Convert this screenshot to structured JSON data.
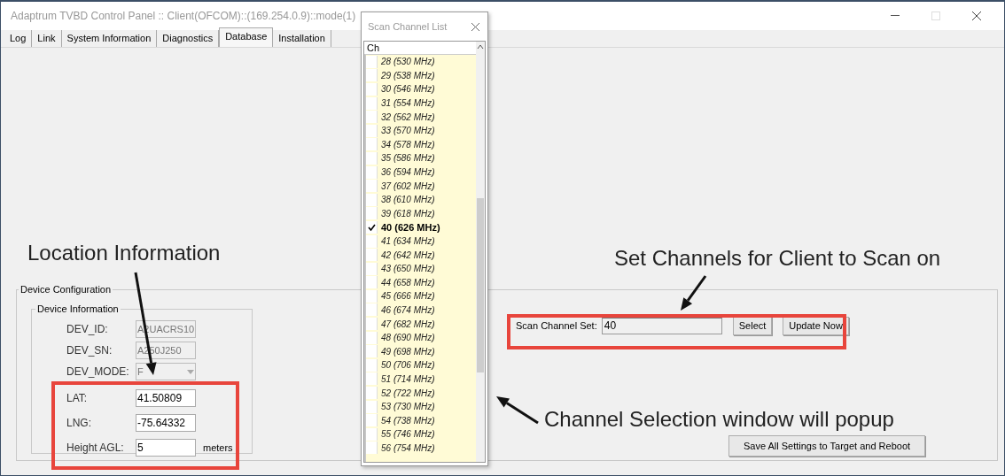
{
  "window": {
    "title": "Adaptrum TVBD Control Panel :: Client(OFCOM)::(169.254.0.9)::mode(1)"
  },
  "tabs": [
    {
      "label": "Log",
      "selected": false
    },
    {
      "label": "Link",
      "selected": false
    },
    {
      "label": "System Information",
      "selected": false
    },
    {
      "label": "Diagnostics",
      "selected": false
    },
    {
      "label": "Database",
      "selected": true
    },
    {
      "label": "Installation",
      "selected": false
    }
  ],
  "device_configuration": {
    "title": "Device Configuration",
    "device_information": {
      "title": "Device Information",
      "fields": [
        {
          "kind": "text",
          "label": "DEV_ID:",
          "value": "A2UACRS10",
          "disabled": true
        },
        {
          "kind": "text",
          "label": "DEV_SN:",
          "value": "A250J250",
          "disabled": true
        },
        {
          "kind": "dropdown",
          "label": "DEV_MODE:",
          "value": "F",
          "disabled": true
        },
        {
          "kind": "text",
          "label": "LAT:",
          "value": "41.50809",
          "disabled": false
        },
        {
          "kind": "text",
          "label": "LNG:",
          "value": "-75.64332",
          "disabled": false
        },
        {
          "kind": "text",
          "label": "Height AGL:",
          "value": "5",
          "disabled": false,
          "unit": "meters"
        }
      ]
    },
    "scan_channel_set": {
      "label": "Scan Channel Set:",
      "value": "40",
      "buttons": [
        "Select",
        "Update Now"
      ]
    },
    "save_button": "Save All Settings to Target and Reboot"
  },
  "popup": {
    "title": "Scan Channel List",
    "column": "Ch",
    "channels": [
      {
        "label": "28 (530 MHz)",
        "checked": false
      },
      {
        "label": "29 (538 MHz)",
        "checked": false
      },
      {
        "label": "30 (546 MHz)",
        "checked": false
      },
      {
        "label": "31 (554 MHz)",
        "checked": false
      },
      {
        "label": "32 (562 MHz)",
        "checked": false
      },
      {
        "label": "33 (570 MHz)",
        "checked": false
      },
      {
        "label": "34 (578 MHz)",
        "checked": false
      },
      {
        "label": "35 (586 MHz)",
        "checked": false
      },
      {
        "label": "36 (594 MHz)",
        "checked": false
      },
      {
        "label": "37 (602 MHz)",
        "checked": false
      },
      {
        "label": "38 (610 MHz)",
        "checked": false
      },
      {
        "label": "39 (618 MHz)",
        "checked": false
      },
      {
        "label": "40 (626 MHz)",
        "checked": true
      },
      {
        "label": "41 (634 MHz)",
        "checked": false
      },
      {
        "label": "42 (642 MHz)",
        "checked": false
      },
      {
        "label": "43 (650 MHz)",
        "checked": false
      },
      {
        "label": "44 (658 MHz)",
        "checked": false
      },
      {
        "label": "45 (666 MHz)",
        "checked": false
      },
      {
        "label": "46 (674 MHz)",
        "checked": false
      },
      {
        "label": "47 (682 MHz)",
        "checked": false
      },
      {
        "label": "48 (690 MHz)",
        "checked": false
      },
      {
        "label": "49 (698 MHz)",
        "checked": false
      },
      {
        "label": "50 (706 MHz)",
        "checked": false
      },
      {
        "label": "51 (714 MHz)",
        "checked": false
      },
      {
        "label": "52 (722 MHz)",
        "checked": false
      },
      {
        "label": "53 (730 MHz)",
        "checked": false
      },
      {
        "label": "54 (738 MHz)",
        "checked": false
      },
      {
        "label": "55 (746 MHz)",
        "checked": false
      },
      {
        "label": "56 (754 MHz)",
        "checked": false
      }
    ]
  },
  "annotations": [
    {
      "text": "Location Information"
    },
    {
      "text": "Set Channels for Client to Scan on"
    },
    {
      "text": "Channel Selection window will popup"
    }
  ]
}
